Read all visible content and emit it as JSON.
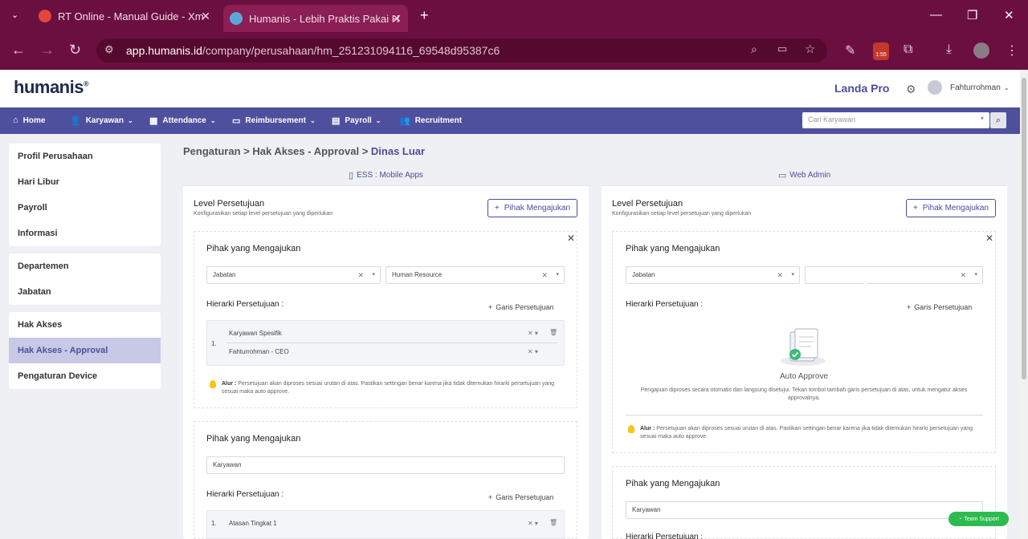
{
  "browser": {
    "tabs": [
      {
        "title": "RT Online - Manual Guide - Xm"
      },
      {
        "title": "Humanis - Lebih Praktis Pakai H"
      }
    ],
    "url_host": "app.humanis.id",
    "url_path": "/company/perusahaan/hm_251231094116_69548d95387c6",
    "badge": "1:55"
  },
  "header": {
    "logo": "humanis",
    "plan": "Landa Pro",
    "user_name": "Fahturrohman"
  },
  "menu": {
    "items": [
      {
        "label": "Home"
      },
      {
        "label": "Karyawan"
      },
      {
        "label": "Attendance"
      },
      {
        "label": "Reimbursement"
      },
      {
        "label": "Payroll"
      },
      {
        "label": "Recruitment"
      }
    ],
    "search_placeholder": "Cari Karyawan"
  },
  "sidebar": {
    "group1": [
      {
        "label": "Profil Perusahaan"
      },
      {
        "label": "Hari Libur"
      },
      {
        "label": "Payroll"
      },
      {
        "label": "Informasi"
      }
    ],
    "group2": [
      {
        "label": "Departemen"
      },
      {
        "label": "Jabatan"
      }
    ],
    "group3": [
      {
        "label": "Hak Akses"
      },
      {
        "label": "Hak Akses - Approval"
      },
      {
        "label": "Pengaturan Device"
      }
    ]
  },
  "breadcrumb": {
    "part1": "Pengaturan",
    "part2": "Hak Akses - Approval",
    "current": "Dinas Luar",
    "sep": ">"
  },
  "left_panel": {
    "title": "ESS : Mobile Apps",
    "level_title": "Level Persetujuan",
    "level_sub": "Konfigurasikan setiap level persetujuan yang diperlukan",
    "add_button": "Pihak Mengajukan",
    "card1": {
      "title": "Pihak yang Mengajukan",
      "select1": "Jabatan",
      "select2": "Human Resource",
      "hier_title": "Hierarki Persetujuan :",
      "add_line": "Garis Persetujuan",
      "row_num": "1.",
      "row1": "Karyawan Spesifik",
      "row2": "Fahturrohman - CEO",
      "note_bold": "Alur :",
      "note": "Persetujuan akan diproses sesuai urutan di atas. Pastikan settingan benar karena jika tidak ditemukan hirarki persetujuan yang sesuai maka auto approve."
    },
    "card2": {
      "title": "Pihak yang Mengajukan",
      "select1": "Karyawan",
      "hier_title": "Hierarki Persetujuan :",
      "add_line": "Garis Persetujuan",
      "row_num": "1.",
      "row1": "Atasan Tingkat 1"
    }
  },
  "right_panel": {
    "title": "Web Admin",
    "level_title": "Level Persetujuan",
    "level_sub": "Konfigurasikan setiap level persetujuan yang diperlukan",
    "add_button": "Pihak Mengajukan",
    "card1": {
      "title": "Pihak yang Mengajukan",
      "select1": "Jabatan",
      "select2": "",
      "hier_title": "Hierarki Persetujuan :",
      "add_line": "Garis Persetujuan",
      "auto_title": "Auto Approve",
      "auto_desc": "Pengajuan diproses secara otomatis dan langsung disetujui. Tekan tombol tambah garis persetujuan di atas, untuk mengatur akses approvalnya.",
      "note_bold": "Alur :",
      "note": "Persetujuan akan diproses sesuai urutan di atas. Pastikan settingan benar karena jika tidak ditemukan hirarki persetujuan yang sesuai maka auto approve."
    },
    "card2": {
      "title": "Pihak yang Mengajukan",
      "select1": "Karyawan",
      "hier_title": "Hierarki Persetujuan :"
    }
  },
  "support_label": "Team Support",
  "colors": {
    "accent": "#4e509e",
    "browser": "#6b0f40",
    "support": "#2dbb4f"
  }
}
